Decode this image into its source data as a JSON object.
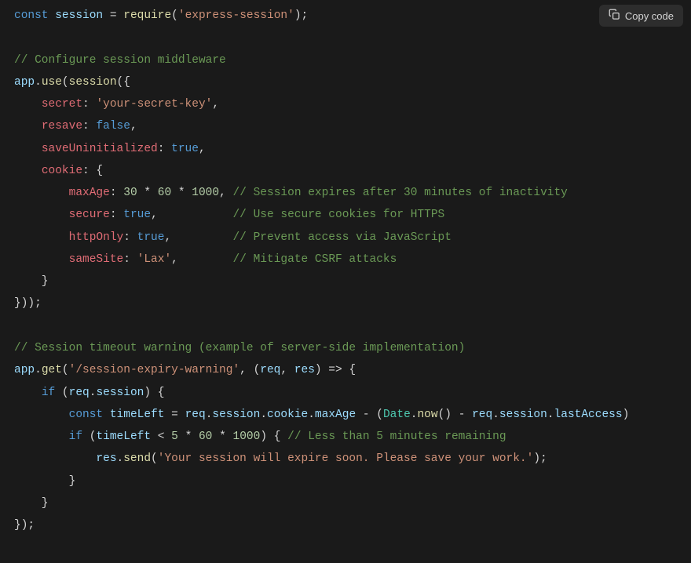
{
  "copy_button": {
    "label": "Copy code"
  },
  "code": {
    "tokens": [
      [
        {
          "t": "const ",
          "c": "kw"
        },
        {
          "t": "session",
          "c": "var"
        },
        {
          "t": " = ",
          "c": "punct"
        },
        {
          "t": "require",
          "c": "fn"
        },
        {
          "t": "(",
          "c": "punct"
        },
        {
          "t": "'express-session'",
          "c": "str"
        },
        {
          "t": ");",
          "c": "punct"
        }
      ],
      [],
      [
        {
          "t": "// Configure session middleware",
          "c": "cmt"
        }
      ],
      [
        {
          "t": "app",
          "c": "var"
        },
        {
          "t": ".",
          "c": "dot"
        },
        {
          "t": "use",
          "c": "fn"
        },
        {
          "t": "(",
          "c": "punct"
        },
        {
          "t": "session",
          "c": "fn"
        },
        {
          "t": "({",
          "c": "punct"
        }
      ],
      [
        {
          "t": "    ",
          "c": "punct"
        },
        {
          "t": "secret",
          "c": "prop"
        },
        {
          "t": ": ",
          "c": "punct"
        },
        {
          "t": "'your-secret-key'",
          "c": "str"
        },
        {
          "t": ",",
          "c": "punct"
        }
      ],
      [
        {
          "t": "    ",
          "c": "punct"
        },
        {
          "t": "resave",
          "c": "prop"
        },
        {
          "t": ": ",
          "c": "punct"
        },
        {
          "t": "false",
          "c": "bool"
        },
        {
          "t": ",",
          "c": "punct"
        }
      ],
      [
        {
          "t": "    ",
          "c": "punct"
        },
        {
          "t": "saveUninitialized",
          "c": "prop"
        },
        {
          "t": ": ",
          "c": "punct"
        },
        {
          "t": "true",
          "c": "bool"
        },
        {
          "t": ",",
          "c": "punct"
        }
      ],
      [
        {
          "t": "    ",
          "c": "punct"
        },
        {
          "t": "cookie",
          "c": "prop"
        },
        {
          "t": ": {",
          "c": "punct"
        }
      ],
      [
        {
          "t": "        ",
          "c": "punct"
        },
        {
          "t": "maxAge",
          "c": "prop"
        },
        {
          "t": ": ",
          "c": "punct"
        },
        {
          "t": "30",
          "c": "num"
        },
        {
          "t": " * ",
          "c": "punct"
        },
        {
          "t": "60",
          "c": "num"
        },
        {
          "t": " * ",
          "c": "punct"
        },
        {
          "t": "1000",
          "c": "num"
        },
        {
          "t": ", ",
          "c": "punct"
        },
        {
          "t": "// Session expires after 30 minutes of inactivity",
          "c": "cmt"
        }
      ],
      [
        {
          "t": "        ",
          "c": "punct"
        },
        {
          "t": "secure",
          "c": "prop"
        },
        {
          "t": ": ",
          "c": "punct"
        },
        {
          "t": "true",
          "c": "bool"
        },
        {
          "t": ",           ",
          "c": "punct"
        },
        {
          "t": "// Use secure cookies for HTTPS",
          "c": "cmt"
        }
      ],
      [
        {
          "t": "        ",
          "c": "punct"
        },
        {
          "t": "httpOnly",
          "c": "prop"
        },
        {
          "t": ": ",
          "c": "punct"
        },
        {
          "t": "true",
          "c": "bool"
        },
        {
          "t": ",         ",
          "c": "punct"
        },
        {
          "t": "// Prevent access via JavaScript",
          "c": "cmt"
        }
      ],
      [
        {
          "t": "        ",
          "c": "punct"
        },
        {
          "t": "sameSite",
          "c": "prop"
        },
        {
          "t": ": ",
          "c": "punct"
        },
        {
          "t": "'Lax'",
          "c": "str"
        },
        {
          "t": ",        ",
          "c": "punct"
        },
        {
          "t": "// Mitigate CSRF attacks",
          "c": "cmt"
        }
      ],
      [
        {
          "t": "    }",
          "c": "punct"
        }
      ],
      [
        {
          "t": "}));",
          "c": "punct"
        }
      ],
      [],
      [
        {
          "t": "// Session timeout warning (example of server-side implementation)",
          "c": "cmt"
        }
      ],
      [
        {
          "t": "app",
          "c": "var"
        },
        {
          "t": ".",
          "c": "dot"
        },
        {
          "t": "get",
          "c": "fn"
        },
        {
          "t": "(",
          "c": "punct"
        },
        {
          "t": "'/session-expiry-warning'",
          "c": "str"
        },
        {
          "t": ", (",
          "c": "punct"
        },
        {
          "t": "req",
          "c": "var"
        },
        {
          "t": ", ",
          "c": "punct"
        },
        {
          "t": "res",
          "c": "var"
        },
        {
          "t": ") => {",
          "c": "punct"
        }
      ],
      [
        {
          "t": "    ",
          "c": "punct"
        },
        {
          "t": "if",
          "c": "kw"
        },
        {
          "t": " (",
          "c": "punct"
        },
        {
          "t": "req",
          "c": "var"
        },
        {
          "t": ".",
          "c": "dot"
        },
        {
          "t": "session",
          "c": "var"
        },
        {
          "t": ") {",
          "c": "punct"
        }
      ],
      [
        {
          "t": "        ",
          "c": "punct"
        },
        {
          "t": "const ",
          "c": "kw"
        },
        {
          "t": "timeLeft",
          "c": "var"
        },
        {
          "t": " = ",
          "c": "punct"
        },
        {
          "t": "req",
          "c": "var"
        },
        {
          "t": ".",
          "c": "dot"
        },
        {
          "t": "session",
          "c": "var"
        },
        {
          "t": ".",
          "c": "dot"
        },
        {
          "t": "cookie",
          "c": "var"
        },
        {
          "t": ".",
          "c": "dot"
        },
        {
          "t": "maxAge",
          "c": "var"
        },
        {
          "t": " - (",
          "c": "punct"
        },
        {
          "t": "Date",
          "c": "obj"
        },
        {
          "t": ".",
          "c": "dot"
        },
        {
          "t": "now",
          "c": "fn"
        },
        {
          "t": "() - ",
          "c": "punct"
        },
        {
          "t": "req",
          "c": "var"
        },
        {
          "t": ".",
          "c": "dot"
        },
        {
          "t": "session",
          "c": "var"
        },
        {
          "t": ".",
          "c": "dot"
        },
        {
          "t": "lastAccess",
          "c": "var"
        },
        {
          "t": ")",
          "c": "punct"
        }
      ],
      [
        {
          "t": "        ",
          "c": "punct"
        },
        {
          "t": "if",
          "c": "kw"
        },
        {
          "t": " (",
          "c": "punct"
        },
        {
          "t": "timeLeft",
          "c": "var"
        },
        {
          "t": " < ",
          "c": "punct"
        },
        {
          "t": "5",
          "c": "num"
        },
        {
          "t": " * ",
          "c": "punct"
        },
        {
          "t": "60",
          "c": "num"
        },
        {
          "t": " * ",
          "c": "punct"
        },
        {
          "t": "1000",
          "c": "num"
        },
        {
          "t": ") { ",
          "c": "punct"
        },
        {
          "t": "// Less than 5 minutes remaining",
          "c": "cmt"
        }
      ],
      [
        {
          "t": "            ",
          "c": "punct"
        },
        {
          "t": "res",
          "c": "var"
        },
        {
          "t": ".",
          "c": "dot"
        },
        {
          "t": "send",
          "c": "fn"
        },
        {
          "t": "(",
          "c": "punct"
        },
        {
          "t": "'Your session will expire soon. Please save your work.'",
          "c": "str"
        },
        {
          "t": ");",
          "c": "punct"
        }
      ],
      [
        {
          "t": "        }",
          "c": "punct"
        }
      ],
      [
        {
          "t": "    }",
          "c": "punct"
        }
      ],
      [
        {
          "t": "});",
          "c": "punct"
        }
      ]
    ]
  }
}
